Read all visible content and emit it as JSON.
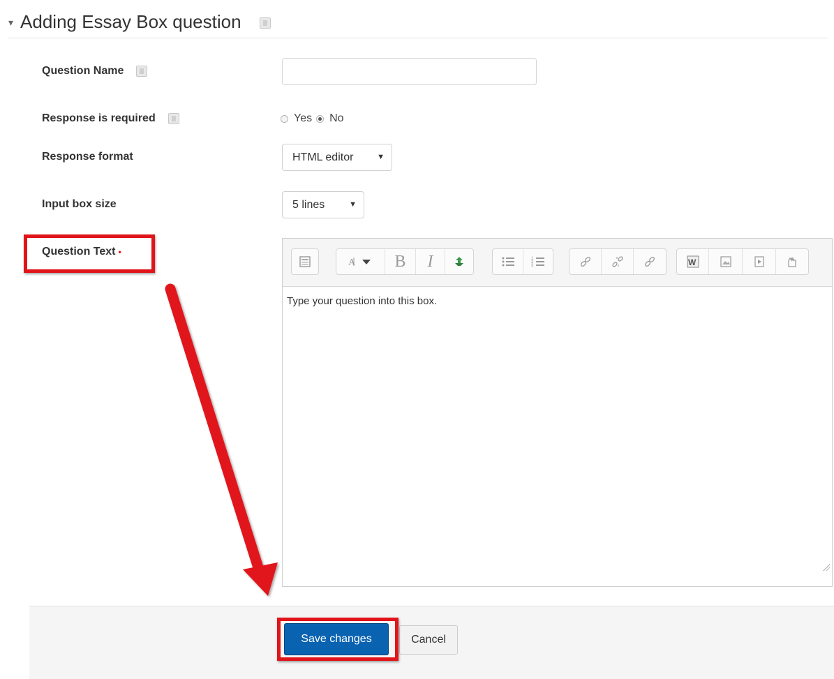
{
  "section": {
    "title": "Adding Essay Box question",
    "collapse_icon": "▾"
  },
  "fields": {
    "question_name": {
      "label": "Question Name",
      "value": ""
    },
    "response_required": {
      "label": "Response is required",
      "options": [
        "Yes",
        "No"
      ],
      "selected": "No"
    },
    "response_format": {
      "label": "Response format",
      "value": "HTML editor"
    },
    "input_box_size": {
      "label": "Input box size",
      "value": "5 lines"
    },
    "question_text": {
      "label": "Question Text",
      "required_marker": "•",
      "content": "Type your question into this box."
    }
  },
  "toolbar": {
    "items": [
      "toolbar-toggle-icon",
      "paragraph-styles-icon",
      "bold-icon",
      "italic-icon",
      "recycle-icon",
      "unordered-list-icon",
      "ordered-list-icon",
      "link-icon",
      "unlink-icon",
      "link-alt-icon",
      "word-import-icon",
      "image-icon",
      "media-icon",
      "manage-files-icon"
    ],
    "bold_glyph": "B",
    "italic_glyph": "I"
  },
  "buttons": {
    "save": "Save changes",
    "cancel": "Cancel"
  },
  "colors": {
    "primary": "#0a63b0",
    "annotation": "#e1141a",
    "recycle": "#3c9a4e"
  }
}
